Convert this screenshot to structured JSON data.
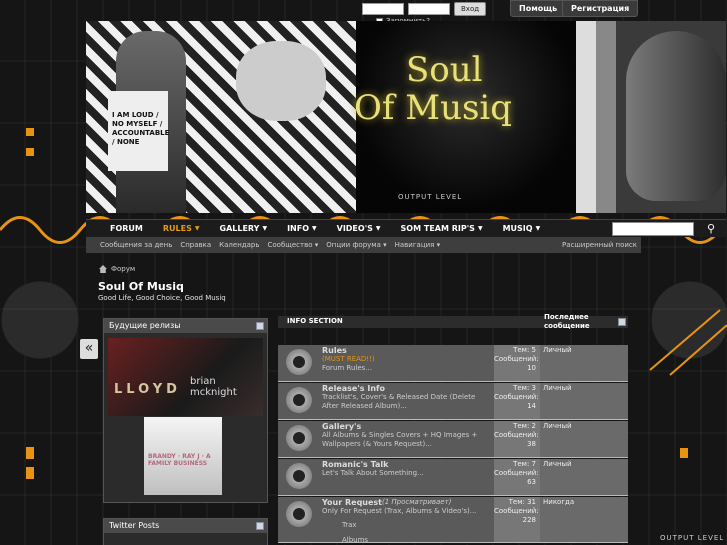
{
  "login": {
    "submit": "Вход",
    "remember": "Запомнить?",
    "help": "Помощь",
    "register": "Регистрация"
  },
  "banner": {
    "logo_line1": "Soul",
    "logo_line2": "Of Musiq",
    "shirt_text": "I AM LOUD / NO MYSELF / ACCOUNTABLE / NONE",
    "output_level": "OUTPUT LEVEL"
  },
  "nav": {
    "items": [
      {
        "label": "FORUM",
        "dropdown": false
      },
      {
        "label": "RULES",
        "dropdown": true,
        "active": true
      },
      {
        "label": "GALLERY",
        "dropdown": true
      },
      {
        "label": "INFO",
        "dropdown": true
      },
      {
        "label": "VIDEO'S",
        "dropdown": true
      },
      {
        "label": "SOM TEAM RIP'S",
        "dropdown": true
      },
      {
        "label": "MUSIQ",
        "dropdown": true
      }
    ],
    "search_placeholder": ""
  },
  "subnav": {
    "items": [
      {
        "label": "Сообщения за день",
        "dropdown": false
      },
      {
        "label": "Справка",
        "dropdown": false
      },
      {
        "label": "Календарь",
        "dropdown": false
      },
      {
        "label": "Сообщество",
        "dropdown": true
      },
      {
        "label": "Опции форума",
        "dropdown": true
      },
      {
        "label": "Навигация",
        "dropdown": true
      }
    ],
    "advanced_search": "Расширенный поиск"
  },
  "breadcrumb": {
    "home": "Форум"
  },
  "board": {
    "title": "Soul Of Musiq",
    "description": "Good Life, Good Choice, Good Musiq"
  },
  "sidebar": {
    "upcoming_title": "Будущие релизы",
    "twitter_title": "Twitter Posts",
    "album1_artist": "LLOYD",
    "album1_secondary": "brian mcknight",
    "album2_text": "BRANDY · RAY J · A FAMILY BUSINESS"
  },
  "forum": {
    "section_title": "INFO SECTION",
    "last_post_header": "Последнее сообщение",
    "rows": [
      {
        "name": "Rules",
        "note": "(MUST READ!!)",
        "description": "Forum Rules...",
        "topics": "Тем: 5",
        "posts_label": "Сообщений:",
        "posts": "10",
        "last": "Личный"
      },
      {
        "name": "Release's Info",
        "note": "",
        "description": "Tracklist's, Cover's & Released Date (Delete After Released Album)...",
        "topics": "Тем: 3",
        "posts_label": "Сообщений:",
        "posts": "14",
        "last": "Личный"
      },
      {
        "name": "Gallery's",
        "note": "",
        "description": "All Albums & Singles Covers + HQ Images + Wallpapers (& Yours Request)...",
        "topics": "Тем: 2",
        "posts_label": "Сообщений:",
        "posts": "38",
        "last": "Личный"
      },
      {
        "name": "Romanic's Talk",
        "note": "",
        "description": "Let's Talk About Something...",
        "topics": "Тем: 7",
        "posts_label": "Сообщений:",
        "posts": "63",
        "last": "Личный"
      },
      {
        "name": "Your Request",
        "note": "(1 Просматривает)",
        "description": "Only For Request (Trax, Albums & Video's)...",
        "topics": "Тем: 31",
        "posts_label": "Сообщений:",
        "posts": "228",
        "last": "Никогда",
        "sub1": "Trax",
        "sub2": "Albums"
      }
    ]
  },
  "colors": {
    "accent": "#e89412",
    "nav_bg": "#1c1c1c",
    "logo": "#e8e07a"
  }
}
